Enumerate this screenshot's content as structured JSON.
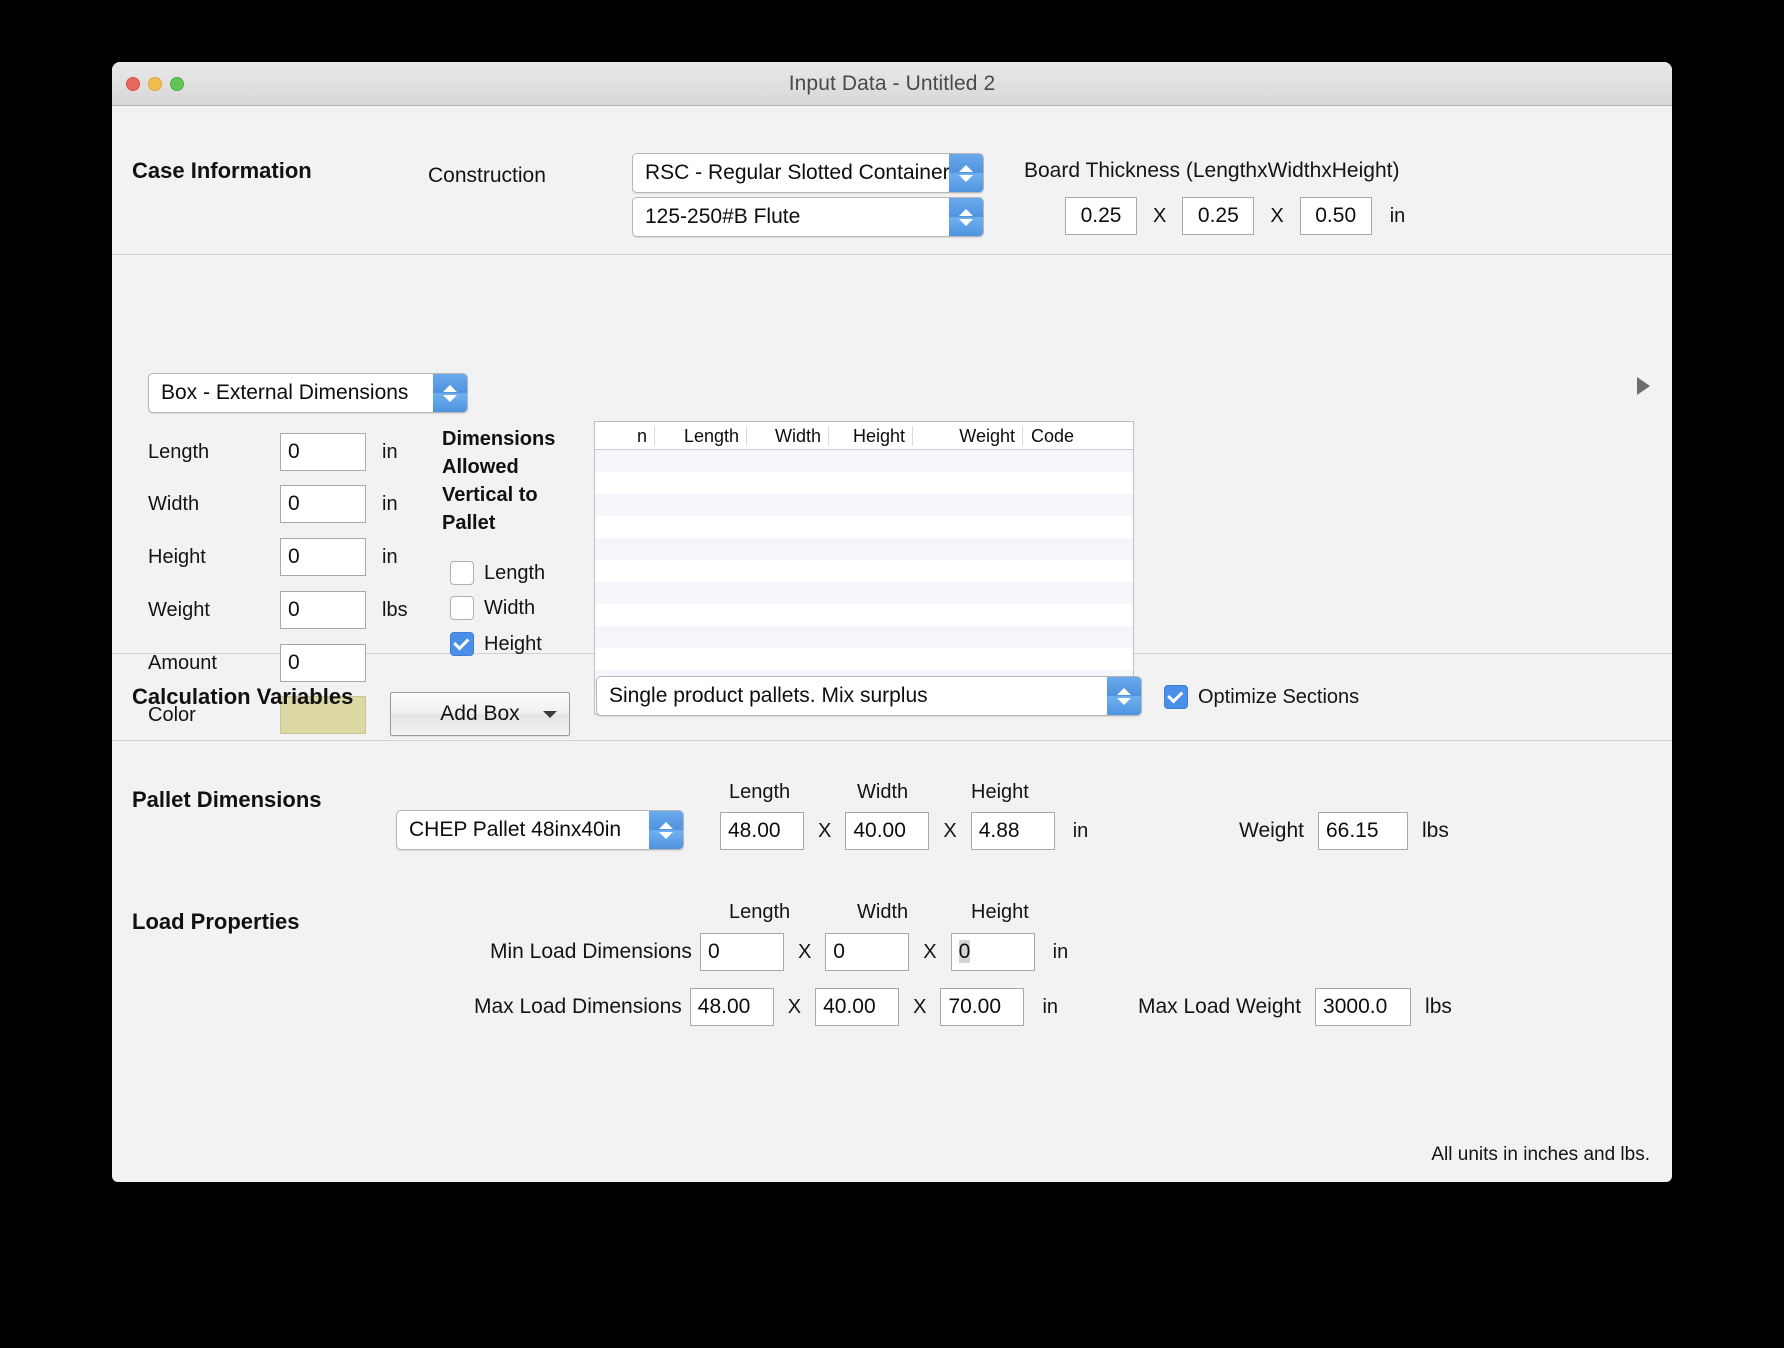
{
  "window": {
    "title": "Input Data - Untitled 2",
    "traffic_lights": {
      "close": "close",
      "minimize": "minimize",
      "maximize": "maximize"
    }
  },
  "case_information": {
    "section_title": "Case Information",
    "construction_label": "Construction",
    "construction_value": "RSC - Regular Slotted Container",
    "flute_value": "125-250#B Flute",
    "board_thickness_label": "Board Thickness (LengthxWidthxHeight)",
    "board_thickness": {
      "length": "0.25",
      "width": "0.25",
      "height": "0.50",
      "x1": "X",
      "x2": "X",
      "unit": "in"
    }
  },
  "box_panel": {
    "dimension_mode": "Box - External Dimensions",
    "fields": {
      "length_label": "Length",
      "length_value": "0",
      "length_unit": "in",
      "width_label": "Width",
      "width_value": "0",
      "width_unit": "in",
      "height_label": "Height",
      "height_value": "0",
      "height_unit": "in",
      "weight_label": "Weight",
      "weight_value": "0",
      "weight_unit": "lbs",
      "amount_label": "Amount",
      "amount_value": "0",
      "color_label": "Color",
      "color_value": "#dcd8a4"
    },
    "dimensions_allowed_title": "Dimensions Allowed Vertical to Pallet",
    "allowed": [
      {
        "label": "Length",
        "checked": false
      },
      {
        "label": "Width",
        "checked": false
      },
      {
        "label": "Height",
        "checked": true
      }
    ],
    "add_box_label": "Add Box",
    "table": {
      "columns": [
        "n",
        "Length",
        "Width",
        "Height",
        "Weight",
        "Code"
      ],
      "rows": []
    }
  },
  "calculation_variables": {
    "section_title": "Calculation Variables",
    "mode_value": "Single product pallets. Mix surplus",
    "optimize_sections_label": "Optimize Sections",
    "optimize_sections_checked": true
  },
  "pallet_dimensions": {
    "section_title": "Pallet Dimensions",
    "pallet_value": "CHEP Pallet 48inx40in",
    "length_label": "Length",
    "width_label": "Width",
    "height_label": "Height",
    "length_value": "48.00",
    "width_value": "40.00",
    "height_value": "4.88",
    "x1": "X",
    "x2": "X",
    "unit": "in",
    "weight_label": "Weight",
    "weight_value": "66.15",
    "weight_unit": "lbs"
  },
  "load_properties": {
    "section_title": "Load Properties",
    "length_label": "Length",
    "width_label": "Width",
    "height_label": "Height",
    "min_label": "Min Load Dimensions",
    "min_length": "0",
    "min_width": "0",
    "min_height": "0",
    "min_x1": "X",
    "min_x2": "X",
    "min_unit": "in",
    "max_label": "Max Load Dimensions",
    "max_length": "48.00",
    "max_width": "40.00",
    "max_height": "70.00",
    "max_x1": "X",
    "max_x2": "X",
    "max_unit": "in",
    "max_weight_label": "Max Load Weight",
    "max_weight_value": "3000.0",
    "max_weight_unit": "lbs"
  },
  "footer": {
    "units_note": "All units in inches and lbs."
  },
  "colors": {
    "accent_blue": "#4a90e8",
    "stepper_blue": "#4f93e0",
    "swatch": "#dcd8a4",
    "window_bg": "#f2f2f2",
    "table_stripe": "#f4f6fb"
  }
}
